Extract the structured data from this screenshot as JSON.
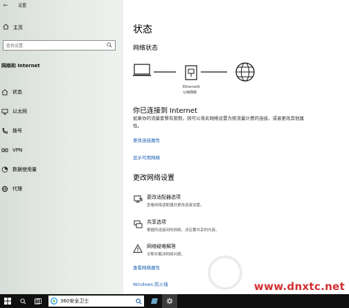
{
  "window": {
    "title": "设置",
    "back_glyph": "←"
  },
  "sidebar": {
    "home_label": "主页",
    "search_placeholder": "查找设置",
    "section_title": "网络和 Internet",
    "items": [
      {
        "label": "状态",
        "icon": "home-globe-icon"
      },
      {
        "label": "以太网",
        "icon": "ethernet-monitor-icon"
      },
      {
        "label": "拨号",
        "icon": "dialup-phone-icon"
      },
      {
        "label": "VPN",
        "icon": "vpn-icon"
      },
      {
        "label": "数据使用量",
        "icon": "data-usage-icon"
      },
      {
        "label": "代理",
        "icon": "proxy-globe-icon"
      }
    ]
  },
  "main": {
    "title": "状态",
    "network_status_heading": "网络状态",
    "adapter_name": "Ethernet0",
    "network_type": "公用网络",
    "connected_text": "你已连接到 Internet",
    "description": "如果你的流量套餐有限制，则可以将此网络设置为按流量计费的连接，或者更改其他属性。",
    "link_change_properties": "更改连接属性",
    "link_show_networks": "显示可用网络",
    "change_settings_heading": "更改网络设置",
    "options": [
      {
        "title": "更改适配器选项",
        "desc": "查看网络适配器并更改连接设置。",
        "icon": "adapter-icon"
      },
      {
        "title": "共享选项",
        "desc": "根据所连接到的网络，决定要共享的内容。",
        "icon": "sharing-icon"
      },
      {
        "title": "网络疑难解答",
        "desc": "诊断并解决网络问题。",
        "icon": "warning-icon"
      }
    ],
    "link_view_properties": "查看网络属性",
    "link_firewall": "Windows 防火墙"
  },
  "watermark": {
    "text": "www.dnxtc.net"
  },
  "taskbar": {
    "search_text": "360安全卫士"
  },
  "colors": {
    "link": "#1a5fb4",
    "sidebar_bg": "#e6ebe6",
    "taskbar_bg": "#101010",
    "watermark": "#d32f2f"
  }
}
